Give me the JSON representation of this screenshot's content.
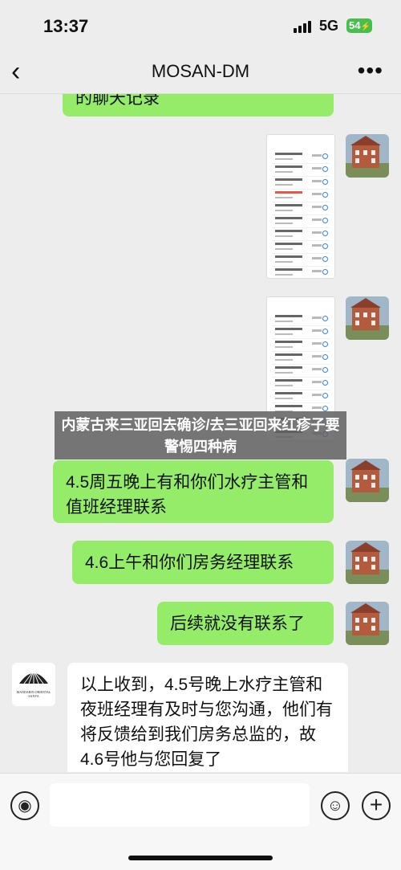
{
  "status": {
    "time": "13:37",
    "network": "5G",
    "battery": "54"
  },
  "nav": {
    "back_icon": "‹",
    "title": "MOSAN-DM",
    "more_icon": "•••"
  },
  "messages": {
    "m1": "的聊天记录",
    "m2": "4.5周五晚上有和你们水疗主管和值班经理联系",
    "m3": "4.6上午和你们房务经理联系",
    "m4": "后续就没有联系了",
    "m5": "以上收到，4.5号晚上水疗主管和夜班经理有及时与您沟通，他们有将反馈给到我们房务总监的，故4.6号他与您回复了"
  },
  "overlay_caption": "内蒙古来三亚回去确诊/去三亚回来红疹子要警惕四种病",
  "hotel_logo": {
    "name": "MANDARIN ORIENTAL",
    "city": "SANYA"
  },
  "input": {
    "voice_icon": "voice-icon",
    "emoji_icon": "emoji-icon",
    "plus_icon": "plus-icon"
  },
  "colors": {
    "bubble_out": "#95ec69",
    "bubble_in": "#ffffff",
    "bg": "#ededed"
  }
}
